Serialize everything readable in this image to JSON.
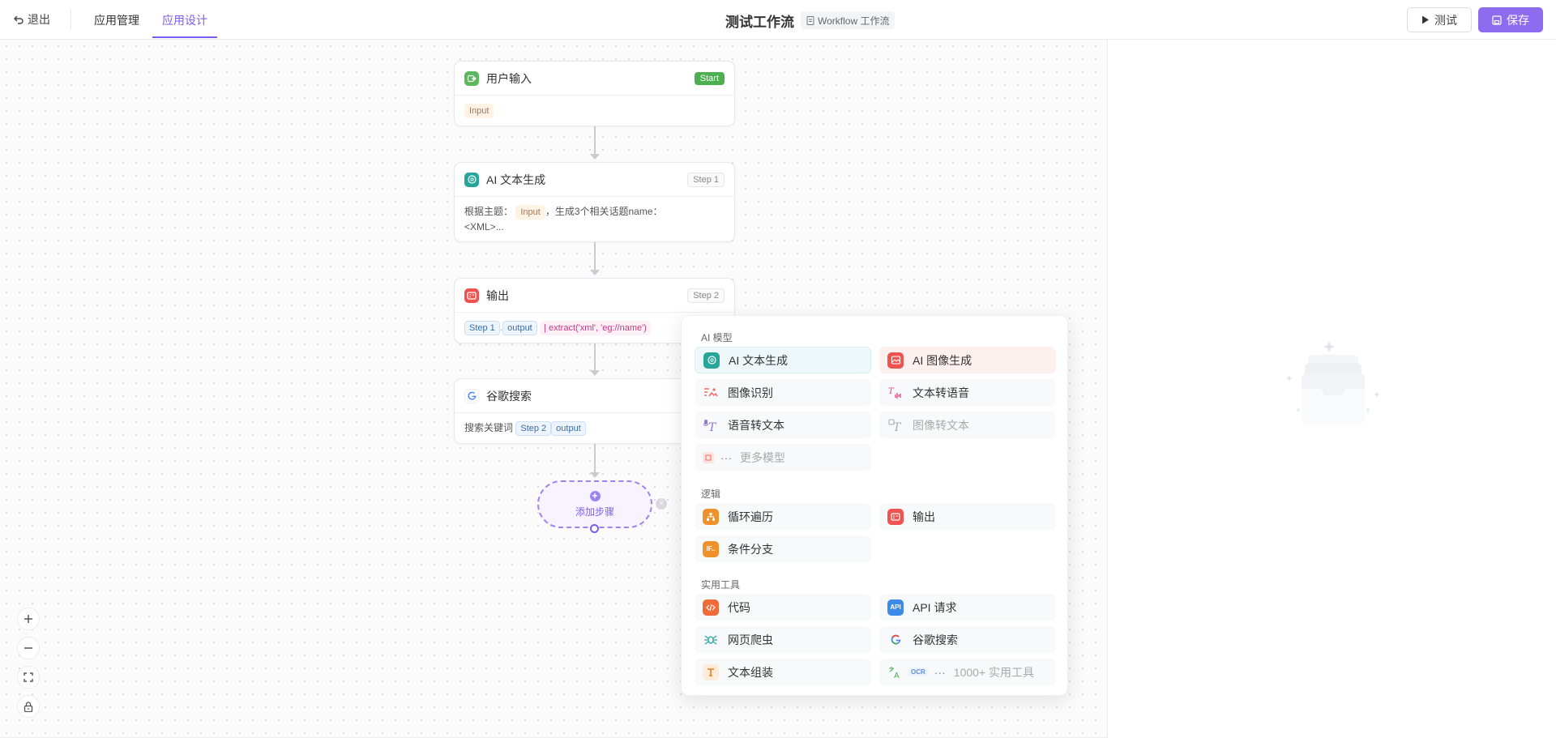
{
  "header": {
    "back_label": "退出",
    "tabs": [
      "应用管理",
      "应用设计"
    ],
    "active_tab": 1,
    "title": "测试工作流",
    "type_badge": "Workflow 工作流",
    "test_label": "测试",
    "save_label": "保存",
    "accent": "#8e6cf0"
  },
  "nodes": [
    {
      "title": "用户输入",
      "badge": "Start",
      "body_tag": "Input"
    },
    {
      "title": "AI 文本生成",
      "badge": "Step 1",
      "body_prefix": "根据主题：",
      "body_tag": "Input",
      "body_suffix": "，生成3个相关话题name：",
      "body_line2": "<XML>..."
    },
    {
      "title": "输出",
      "badge": "Step 2",
      "tag1": "Step 1",
      "tag2": "output",
      "filter": "| extract('xml', 'eg://name')"
    },
    {
      "title": "谷歌搜索",
      "body_prefix": "搜索关键词",
      "tag1": "Step 2",
      "tag2": "output"
    }
  ],
  "add_step_label": "添加步骤",
  "zoom_controls": [
    "zoom-in",
    "zoom-out",
    "fit-view",
    "lock"
  ],
  "popup": {
    "sections": [
      {
        "title": "AI 模型",
        "items": [
          "AI 文本生成",
          "AI 图像生成",
          "图像识别",
          "文本转语音",
          "语音转文本",
          "图像转文本",
          "更多模型"
        ]
      },
      {
        "title": "逻辑",
        "items": [
          "循环遍历",
          "输出",
          "条件分支"
        ]
      },
      {
        "title": "实用工具",
        "items": [
          "代码",
          "API 请求",
          "网页爬虫",
          "谷歌搜索",
          "文本组装",
          "1000+ 实用工具"
        ]
      }
    ],
    "more_dots": "···",
    "if_icon_text": "IF..",
    "api_icon_text": "API",
    "ocr_icon_text": "OCR"
  }
}
